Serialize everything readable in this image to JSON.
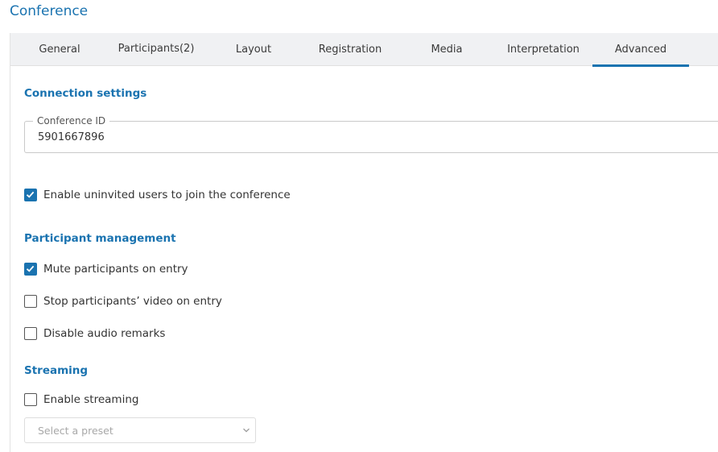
{
  "header": {
    "title": "Conference"
  },
  "tabs": [
    {
      "label": "General",
      "active": false
    },
    {
      "label": "Participants(2)",
      "active": false
    },
    {
      "label": "Layout",
      "active": false
    },
    {
      "label": "Registration",
      "active": false
    },
    {
      "label": "Media",
      "active": false
    },
    {
      "label": "Interpretation",
      "active": false
    },
    {
      "label": "Advanced",
      "active": true
    }
  ],
  "connection": {
    "title": "Connection settings",
    "conference_id_label": "Conference ID",
    "conference_id_value": "5901667896",
    "uninvited_label": "Enable uninvited users to join the conference",
    "uninvited_checked": true
  },
  "participant_management": {
    "title": "Participant management",
    "options": [
      {
        "label": "Mute participants on entry",
        "checked": true
      },
      {
        "label": "Stop participants’ video on entry",
        "checked": false
      },
      {
        "label": "Disable audio remarks",
        "checked": false
      }
    ]
  },
  "streaming": {
    "title": "Streaming",
    "enable_label": "Enable streaming",
    "enable_checked": false,
    "preset_placeholder": "Select a preset"
  },
  "colors": {
    "accent": "#1a73b0",
    "tabbar_bg": "#f0f1f3"
  },
  "icons": {
    "check": "check-icon",
    "chevron": "chevron-down-icon"
  }
}
